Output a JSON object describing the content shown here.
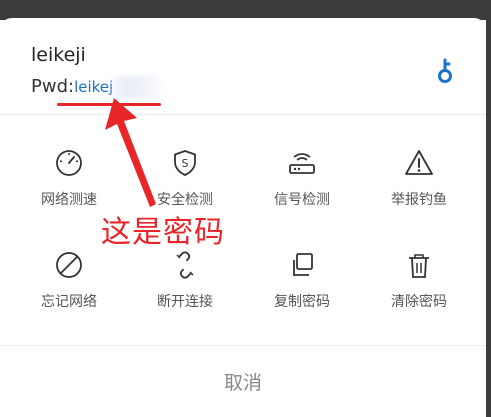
{
  "wifi": {
    "ssid": "leikeji",
    "password_label": "Pwd:",
    "password_value": "leikej"
  },
  "actions": [
    {
      "label": "网络测速",
      "icon": "speedometer-icon"
    },
    {
      "label": "安全检测",
      "icon": "shield-s-icon"
    },
    {
      "label": "信号检测",
      "icon": "router-icon"
    },
    {
      "label": "举报钓鱼",
      "icon": "warning-icon"
    },
    {
      "label": "忘记网络",
      "icon": "forbidden-icon"
    },
    {
      "label": "断开连接",
      "icon": "broken-link-icon"
    },
    {
      "label": "复制密码",
      "icon": "copy-icon"
    },
    {
      "label": "清除密码",
      "icon": "trash-icon"
    }
  ],
  "annotation": {
    "text": "这是密码",
    "color": "#e8262a"
  },
  "cancel_label": "取消",
  "colors": {
    "accent": "#1a73c8",
    "annotation_red": "#e8262a",
    "icon": "#333333"
  }
}
